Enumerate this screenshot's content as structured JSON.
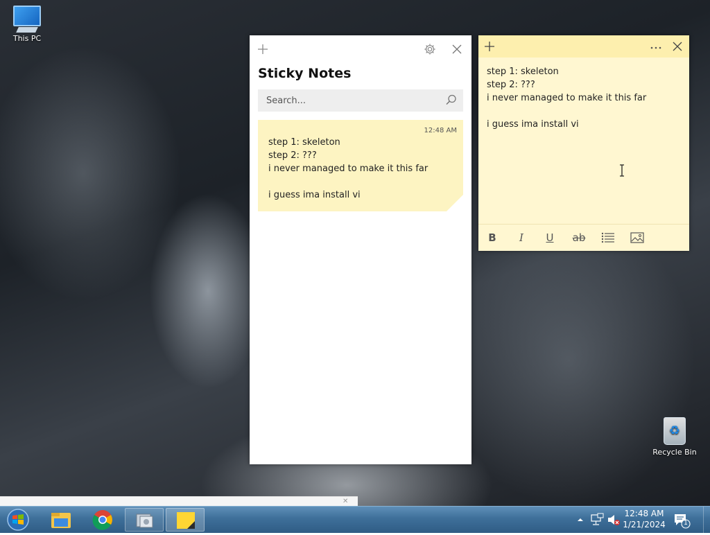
{
  "desktop": {
    "icons": [
      {
        "label": "This PC"
      },
      {
        "label": "Recycle Bin"
      }
    ]
  },
  "notes_list": {
    "title": "Sticky Notes",
    "search_placeholder": "Search...",
    "notes": [
      {
        "time": "12:48 AM",
        "lines": [
          "step 1: skeleton",
          "step 2: ???",
          "i never managed to make it this far",
          "",
          "i guess ima install vi"
        ]
      }
    ]
  },
  "note_window": {
    "lines": [
      "step 1: skeleton",
      "step 2: ???",
      "i never managed to make it this far",
      "",
      "i guess ima install vi"
    ],
    "format_buttons": [
      "bold",
      "italic",
      "underline",
      "strikethrough",
      "bullets",
      "image"
    ]
  },
  "taskbar": {
    "clock_time": "12:48 AM",
    "clock_date": "1/21/2024",
    "notification_count": "1",
    "apps": [
      "start",
      "file-explorer",
      "chrome",
      "unknown-app",
      "sticky-notes"
    ]
  },
  "colors": {
    "note_yellow": "#fdf4c2",
    "note_header": "#fdefae",
    "taskbar": "#3e6f99"
  }
}
